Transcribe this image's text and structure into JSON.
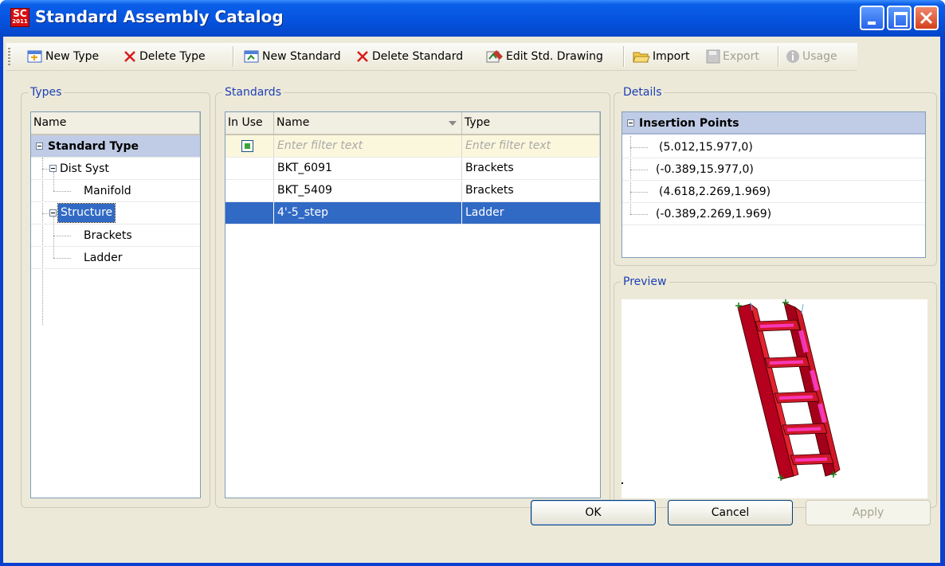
{
  "window": {
    "title": "Standard Assembly Catalog",
    "app_icon_top": "SC",
    "app_icon_bottom": "2011"
  },
  "toolbar": {
    "new_type": "New Type",
    "delete_type": "Delete Type",
    "new_standard": "New Standard",
    "delete_standard": "Delete Standard",
    "edit_drawing": "Edit Std. Drawing",
    "import": "Import",
    "export": "Export",
    "usage": "Usage"
  },
  "types": {
    "group_label": "Types",
    "column": "Name",
    "root": "Standard Type",
    "items": [
      {
        "label": "Dist Syst",
        "level": 1,
        "expanded": true
      },
      {
        "label": "Manifold",
        "level": 2
      },
      {
        "label": "Structure",
        "level": 1,
        "expanded": true,
        "selected": true
      },
      {
        "label": "Brackets",
        "level": 2
      },
      {
        "label": "Ladder",
        "level": 2
      }
    ]
  },
  "standards": {
    "group_label": "Standards",
    "columns": {
      "in_use": "In Use",
      "name": "Name",
      "type": "Type"
    },
    "filter_placeholder": "Enter filter text",
    "rows": [
      {
        "name": "BKT_6091",
        "type": "Brackets",
        "selected": false
      },
      {
        "name": "BKT_5409",
        "type": "Brackets",
        "selected": false
      },
      {
        "name": "4'-5_step",
        "type": "Ladder",
        "selected": true
      }
    ]
  },
  "details": {
    "group_label": "Details",
    "section": "Insertion Points",
    "points": [
      "(5.012,15.977,0)",
      "(-0.389,15.977,0)",
      "(4.618,2.269,1.969)",
      "(-0.389,2.269,1.969)"
    ]
  },
  "preview": {
    "group_label": "Preview",
    "accent": "#c8001a",
    "highlight": "#ff3fd0"
  },
  "buttons": {
    "ok": "OK",
    "cancel": "Cancel",
    "apply": "Apply"
  },
  "colors": {
    "titlebar": "#0553df",
    "selection": "#316ac5",
    "group_label": "#1e3fb4"
  }
}
